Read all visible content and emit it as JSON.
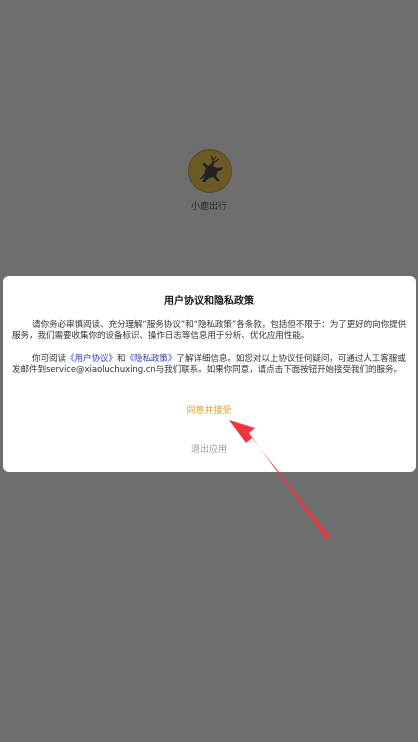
{
  "app": {
    "name": "小鹿出行",
    "logo_icon": "deer-logo-icon"
  },
  "dialog": {
    "title": "用户协议和隐私政策",
    "para1": "请你务必审慎阅读、充分理解“服务协议”和“隐私政策”各条款，包括但不限于：为了更好的向你提供服务，我们需要收集你的设备标识、操作日志等信息用于分析、优化应用性能。",
    "para2_prefix": "你可阅读",
    "user_agreement_link": "《用户协议》",
    "para2_and": "和",
    "privacy_policy_link": "《隐私政策》",
    "para2_suffix": "了解详细信息。如您对以上协议任何疑问，可通过人工客服或发邮件到service@xiaoluchuxing.cn与我们联系。如果你同意，请点击下面按钮开始接受我们的服务。",
    "agree_label": "同意并接受",
    "exit_label": "退出应用"
  },
  "colors": {
    "overlay": "#6e6e6e",
    "agree": "#e0a22a",
    "exit": "#9a9a9a",
    "link": "#2f3fb8",
    "annotation_arrow": "#f2343c"
  },
  "annotation": {
    "icon": "red-arrow-icon"
  }
}
